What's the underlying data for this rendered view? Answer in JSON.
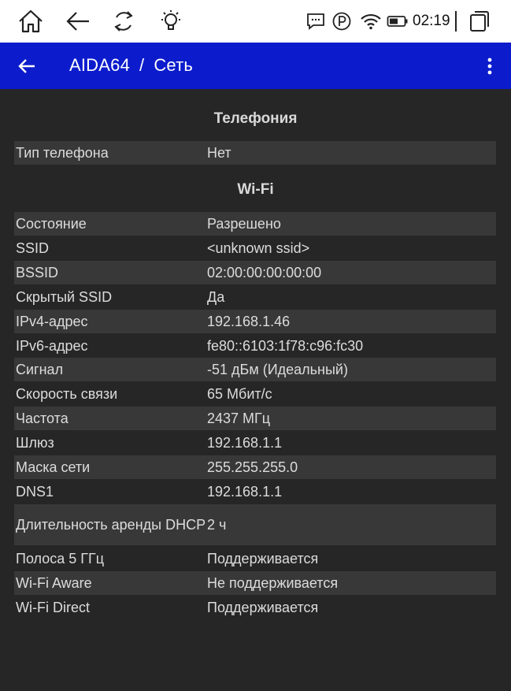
{
  "status_bar": {
    "icons": [
      "home-icon",
      "back-arrow-icon",
      "rotate-icon",
      "lightbulb-icon",
      "message-icon",
      "parking-icon",
      "wifi-icon",
      "battery-icon",
      "recent-apps-icon"
    ],
    "time": "02:19"
  },
  "app_bar": {
    "app_name": "AIDA64",
    "separator": "/",
    "page": "Сеть",
    "background": "#0c1ccc"
  },
  "sections": {
    "telephony": {
      "title": "Телефония",
      "rows": [
        {
          "label": "Тип телефона",
          "value": "Нет"
        }
      ]
    },
    "wifi": {
      "title": "Wi-Fi",
      "rows": [
        {
          "label": "Состояние",
          "value": "Разрешено"
        },
        {
          "label": "SSID",
          "value": "<unknown ssid>"
        },
        {
          "label": "BSSID",
          "value": "02:00:00:00:00:00"
        },
        {
          "label": "Скрытый SSID",
          "value": "Да"
        },
        {
          "label": "IPv4-адрес",
          "value": "192.168.1.46"
        },
        {
          "label": "IPv6-адрес",
          "value": "fe80::6103:1f78:c96:fc30"
        },
        {
          "label": "Сигнал",
          "value": "-51 дБм (Идеальный)"
        },
        {
          "label": "Скорость связи",
          "value": "65 Мбит/с"
        },
        {
          "label": "Частота",
          "value": "2437 МГц"
        },
        {
          "label": "Шлюз",
          "value": "192.168.1.1"
        },
        {
          "label": "Маска сети",
          "value": "255.255.255.0"
        },
        {
          "label": "DNS1",
          "value": "192.168.1.1"
        },
        {
          "label": "Длительность аренды DHCP",
          "value": "2 ч"
        },
        {
          "label": "Полоса 5 ГГц",
          "value": "Поддерживается"
        },
        {
          "label": "Wi-Fi Aware",
          "value": "Не поддерживается"
        },
        {
          "label": "Wi-Fi Direct",
          "value": "Поддерживается"
        }
      ]
    }
  }
}
